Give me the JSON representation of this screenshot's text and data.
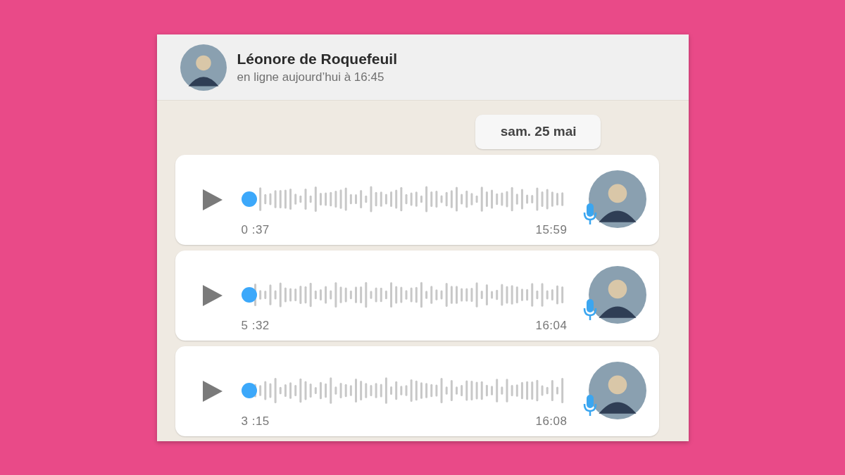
{
  "contact": {
    "name": "Léonore de Roquefeuil",
    "status": "en ligne aujourd’hui à 16:45"
  },
  "date_separator": "sam. 25 mai",
  "messages": [
    {
      "kind": "voice",
      "duration": "0 :37",
      "time": "15:59"
    },
    {
      "kind": "voice",
      "duration": "5 :32",
      "time": "16:04"
    },
    {
      "kind": "voice",
      "duration": "3 :15",
      "time": "16:08"
    }
  ]
}
